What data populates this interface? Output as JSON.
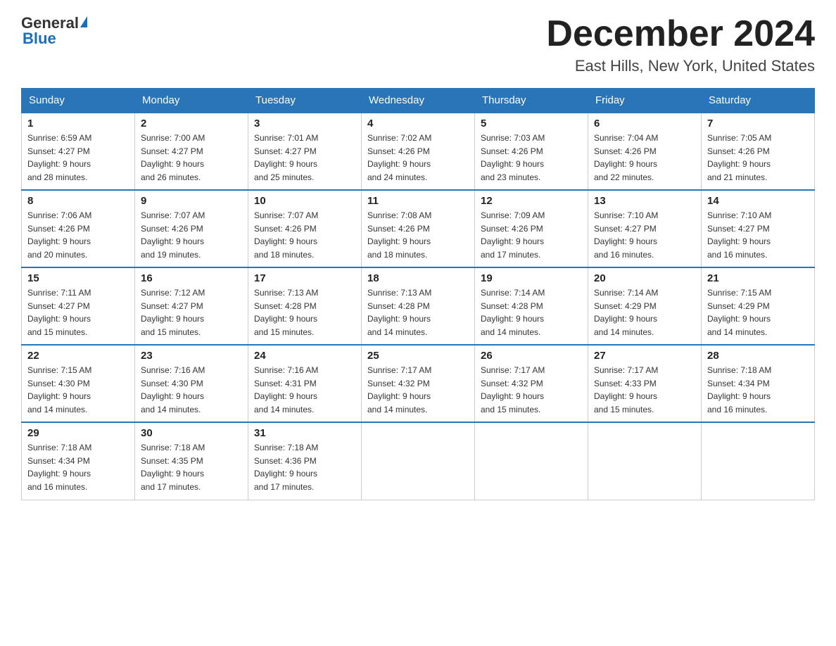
{
  "logo": {
    "general": "General",
    "blue": "Blue"
  },
  "title": "December 2024",
  "location": "East Hills, New York, United States",
  "days_of_week": [
    "Sunday",
    "Monday",
    "Tuesday",
    "Wednesday",
    "Thursday",
    "Friday",
    "Saturday"
  ],
  "weeks": [
    [
      {
        "day": "1",
        "sunrise": "6:59 AM",
        "sunset": "4:27 PM",
        "daylight": "9 hours and 28 minutes."
      },
      {
        "day": "2",
        "sunrise": "7:00 AM",
        "sunset": "4:27 PM",
        "daylight": "9 hours and 26 minutes."
      },
      {
        "day": "3",
        "sunrise": "7:01 AM",
        "sunset": "4:27 PM",
        "daylight": "9 hours and 25 minutes."
      },
      {
        "day": "4",
        "sunrise": "7:02 AM",
        "sunset": "4:26 PM",
        "daylight": "9 hours and 24 minutes."
      },
      {
        "day": "5",
        "sunrise": "7:03 AM",
        "sunset": "4:26 PM",
        "daylight": "9 hours and 23 minutes."
      },
      {
        "day": "6",
        "sunrise": "7:04 AM",
        "sunset": "4:26 PM",
        "daylight": "9 hours and 22 minutes."
      },
      {
        "day": "7",
        "sunrise": "7:05 AM",
        "sunset": "4:26 PM",
        "daylight": "9 hours and 21 minutes."
      }
    ],
    [
      {
        "day": "8",
        "sunrise": "7:06 AM",
        "sunset": "4:26 PM",
        "daylight": "9 hours and 20 minutes."
      },
      {
        "day": "9",
        "sunrise": "7:07 AM",
        "sunset": "4:26 PM",
        "daylight": "9 hours and 19 minutes."
      },
      {
        "day": "10",
        "sunrise": "7:07 AM",
        "sunset": "4:26 PM",
        "daylight": "9 hours and 18 minutes."
      },
      {
        "day": "11",
        "sunrise": "7:08 AM",
        "sunset": "4:26 PM",
        "daylight": "9 hours and 18 minutes."
      },
      {
        "day": "12",
        "sunrise": "7:09 AM",
        "sunset": "4:26 PM",
        "daylight": "9 hours and 17 minutes."
      },
      {
        "day": "13",
        "sunrise": "7:10 AM",
        "sunset": "4:27 PM",
        "daylight": "9 hours and 16 minutes."
      },
      {
        "day": "14",
        "sunrise": "7:10 AM",
        "sunset": "4:27 PM",
        "daylight": "9 hours and 16 minutes."
      }
    ],
    [
      {
        "day": "15",
        "sunrise": "7:11 AM",
        "sunset": "4:27 PM",
        "daylight": "9 hours and 15 minutes."
      },
      {
        "day": "16",
        "sunrise": "7:12 AM",
        "sunset": "4:27 PM",
        "daylight": "9 hours and 15 minutes."
      },
      {
        "day": "17",
        "sunrise": "7:13 AM",
        "sunset": "4:28 PM",
        "daylight": "9 hours and 15 minutes."
      },
      {
        "day": "18",
        "sunrise": "7:13 AM",
        "sunset": "4:28 PM",
        "daylight": "9 hours and 14 minutes."
      },
      {
        "day": "19",
        "sunrise": "7:14 AM",
        "sunset": "4:28 PM",
        "daylight": "9 hours and 14 minutes."
      },
      {
        "day": "20",
        "sunrise": "7:14 AM",
        "sunset": "4:29 PM",
        "daylight": "9 hours and 14 minutes."
      },
      {
        "day": "21",
        "sunrise": "7:15 AM",
        "sunset": "4:29 PM",
        "daylight": "9 hours and 14 minutes."
      }
    ],
    [
      {
        "day": "22",
        "sunrise": "7:15 AM",
        "sunset": "4:30 PM",
        "daylight": "9 hours and 14 minutes."
      },
      {
        "day": "23",
        "sunrise": "7:16 AM",
        "sunset": "4:30 PM",
        "daylight": "9 hours and 14 minutes."
      },
      {
        "day": "24",
        "sunrise": "7:16 AM",
        "sunset": "4:31 PM",
        "daylight": "9 hours and 14 minutes."
      },
      {
        "day": "25",
        "sunrise": "7:17 AM",
        "sunset": "4:32 PM",
        "daylight": "9 hours and 14 minutes."
      },
      {
        "day": "26",
        "sunrise": "7:17 AM",
        "sunset": "4:32 PM",
        "daylight": "9 hours and 15 minutes."
      },
      {
        "day": "27",
        "sunrise": "7:17 AM",
        "sunset": "4:33 PM",
        "daylight": "9 hours and 15 minutes."
      },
      {
        "day": "28",
        "sunrise": "7:18 AM",
        "sunset": "4:34 PM",
        "daylight": "9 hours and 16 minutes."
      }
    ],
    [
      {
        "day": "29",
        "sunrise": "7:18 AM",
        "sunset": "4:34 PM",
        "daylight": "9 hours and 16 minutes."
      },
      {
        "day": "30",
        "sunrise": "7:18 AM",
        "sunset": "4:35 PM",
        "daylight": "9 hours and 17 minutes."
      },
      {
        "day": "31",
        "sunrise": "7:18 AM",
        "sunset": "4:36 PM",
        "daylight": "9 hours and 17 minutes."
      },
      null,
      null,
      null,
      null
    ]
  ],
  "labels": {
    "sunrise": "Sunrise:",
    "sunset": "Sunset:",
    "daylight": "Daylight: 9 hours"
  }
}
